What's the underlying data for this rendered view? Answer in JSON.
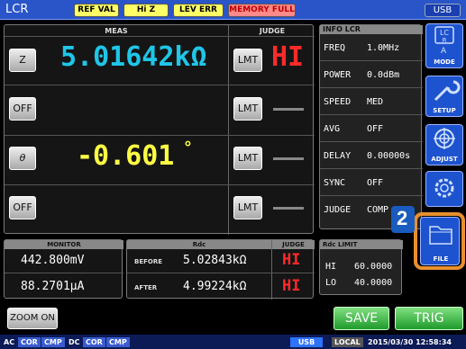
{
  "app_label": "LCR",
  "flags": [
    "REF VAL",
    "Hi Z",
    "LEV ERR",
    "MEMORY FULL"
  ],
  "usb_label": "USB",
  "main": {
    "meas_header": "MEAS",
    "judge_header": "JUDGE",
    "rows": [
      {
        "param": "Z",
        "value": "5.01642kΩ",
        "value_color": "#1fc6e8",
        "lmt": "LMT",
        "judge": "HI"
      },
      {
        "param": "OFF",
        "value": "",
        "lmt": "LMT",
        "judge": "——"
      },
      {
        "param": "θ",
        "value": "-0.601",
        "unit": "°",
        "value_color": "#ffff44",
        "lmt": "LMT",
        "judge": "——"
      },
      {
        "param": "OFF",
        "value": "",
        "lmt": "LMT",
        "judge": "——"
      }
    ]
  },
  "info": {
    "header": "INFO LCR",
    "rows": [
      {
        "label": "FREQ",
        "value": "1.0MHz"
      },
      {
        "label": "POWER",
        "value": "0.0dBm"
      },
      {
        "label": "SPEED",
        "value": "MED"
      },
      {
        "label": "AVG",
        "value": "OFF"
      },
      {
        "label": "DELAY",
        "value": "0.00000s"
      },
      {
        "label": "SYNC",
        "value": "OFF"
      },
      {
        "label": "JUDGE",
        "value": "COMP"
      }
    ]
  },
  "side_buttons": {
    "mode": "MODE",
    "setup": "SETUP",
    "adjust": "ADJUST",
    "file": "FILE"
  },
  "callout_number": "2",
  "monitor": {
    "header": "MONITOR",
    "values": [
      "442.800mV",
      "88.2701μA"
    ]
  },
  "rdc": {
    "header": "Rdc",
    "judge_header": "JUDGE",
    "before_label": "BEFORE",
    "before_value": "5.02843kΩ",
    "before_judge": "HI",
    "after_label": "AFTER",
    "after_value": "4.99224kΩ",
    "after_judge": "HI"
  },
  "rdc_limit": {
    "header": "Rdc LIMIT",
    "hi_label": "HI",
    "hi_value": "60.0000",
    "lo_label": "LO",
    "lo_value": "40.0000"
  },
  "buttons": {
    "zoom": "ZOOM ON",
    "save": "SAVE",
    "trig": "TRIG"
  },
  "status_bar": {
    "ac": "AC",
    "ac_cor": "COR",
    "ac_cmp": "CMP",
    "dc": "DC",
    "dc_cor": "COR",
    "dc_cmp": "CMP",
    "usb": "USB",
    "local": "LOCAL",
    "datetime": "2015/03/30 12:58:34"
  }
}
